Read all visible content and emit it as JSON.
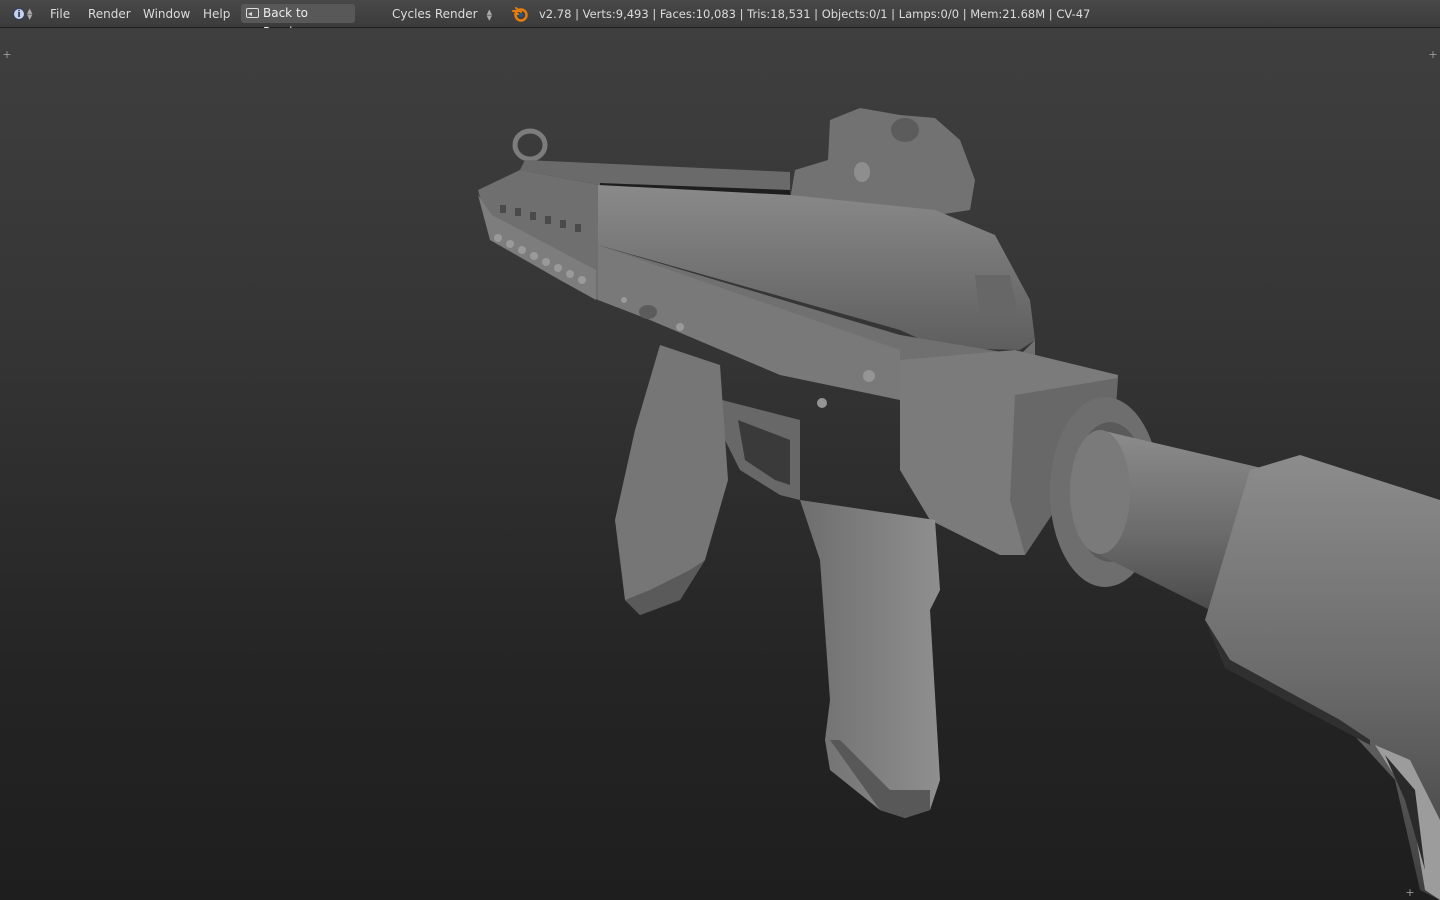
{
  "header": {
    "editor_type_icon": "info-icon",
    "menus": [
      "File",
      "Render",
      "Window",
      "Help"
    ],
    "back_button_label": "Back to Previous",
    "render_engine": "Cycles Render",
    "stats": "v2.78 | Verts:9,493 | Faces:10,083 | Tris:18,531 | Objects:0/1 | Lamps:0/0 | Mem:21.68M | CV-47"
  },
  "viewport": {
    "background_top": "#3f3f3f",
    "background_bottom": "#1e1e1e",
    "model_color": "#7a7a7a"
  }
}
